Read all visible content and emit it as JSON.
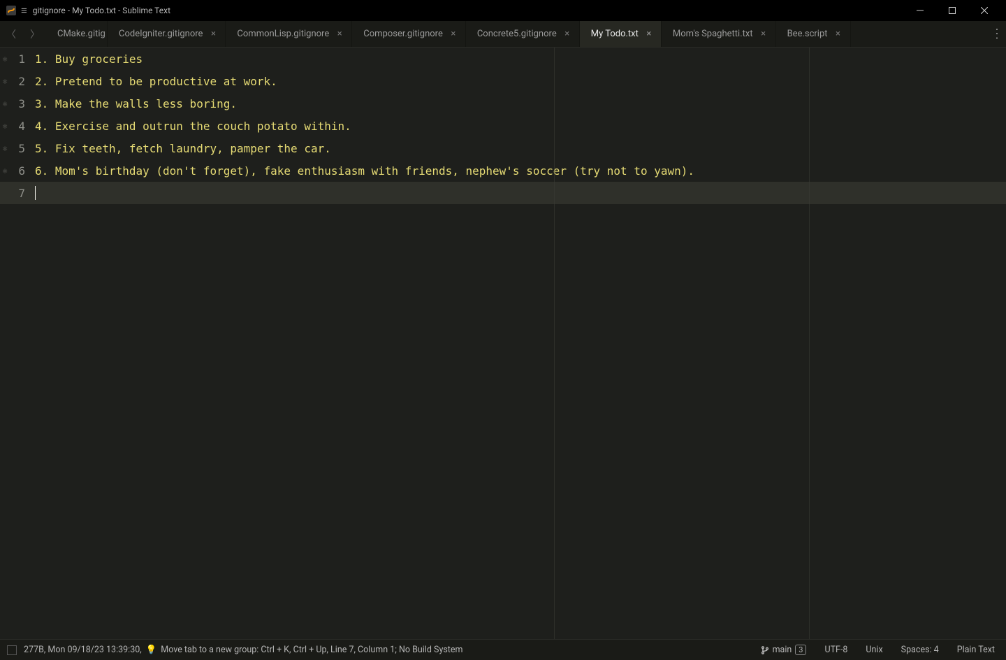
{
  "window": {
    "title": "gitignore - My Todo.txt - Sublime Text"
  },
  "tabs": [
    {
      "label": "CMake.gitig",
      "closeable": false,
      "active": false
    },
    {
      "label": "CodeIgniter.gitignore",
      "closeable": true,
      "active": false
    },
    {
      "label": "CommonLisp.gitignore",
      "closeable": true,
      "active": false
    },
    {
      "label": "Composer.gitignore",
      "closeable": true,
      "active": false
    },
    {
      "label": "Concrete5.gitignore",
      "closeable": true,
      "active": false
    },
    {
      "label": "My Todo.txt",
      "closeable": true,
      "active": true
    },
    {
      "label": "Mom's Spaghetti.txt",
      "closeable": true,
      "active": false
    },
    {
      "label": "Bee.script",
      "closeable": true,
      "active": false
    }
  ],
  "editor_lines": [
    "1. Buy groceries",
    "2. Pretend to be productive at work.",
    "3. Make the walls less boring.",
    "4. Exercise and outrun the couch potato within.",
    "5. Fix teeth, fetch laundry, pamper the car.",
    "6. Mom's birthday (don't forget), fake enthusiasm with friends, nephew's soccer (try not to yawn).",
    ""
  ],
  "cursor_line": 7,
  "status": {
    "left_prefix": "277B, Mon 09/18/23 13:39:30, ",
    "tip": "Move tab to a new group: Ctrl + K, Ctrl + Up, Line 7, Column 1; No Build System",
    "branch_name": "main",
    "branch_count": "3",
    "encoding": "UTF-8",
    "line_endings": "Unix",
    "indent": "Spaces: 4",
    "syntax": "Plain Text"
  }
}
